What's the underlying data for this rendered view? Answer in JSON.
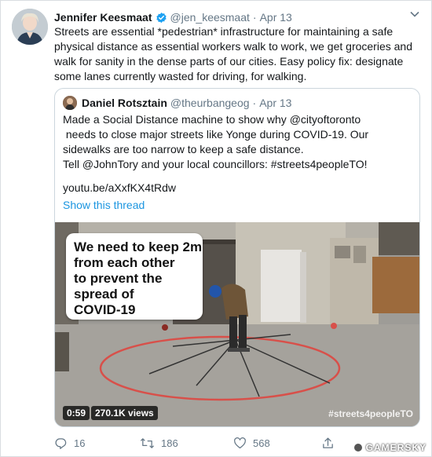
{
  "colors": {
    "link": "#1b95e0",
    "muted": "#657786",
    "verified": "#1da1f2",
    "border": "#ccd6dd"
  },
  "tweet": {
    "author_name": "Jennifer Keesmaat",
    "handle": "@jen_keesmaat",
    "separator": "·",
    "date": "Apr 13",
    "text": "Streets are essential *pedestrian* infrastructure for maintaining a safe physical distance as essential workers walk to work, we get groceries and walk for sanity in the dense parts of our cities. Easy policy fix: designate some lanes currently wasted for driving, for walking.",
    "verified_icon": "verified-badge-icon",
    "menu_icon": "chevron-down-icon"
  },
  "quote": {
    "author_name": "Daniel Rotsztain",
    "handle": "@theurbangeog",
    "separator": "·",
    "date": "Apr 13",
    "lines": [
      "Made a Social Distance machine to show why @cityoftoronto",
      " needs to close major streets like Yonge during COVID-19. Our",
      "sidewalks are too narrow to keep a safe distance.",
      "Tell @JohnTory and your local councillors: #streets4peopleTO!"
    ],
    "link": "youtu.be/aXxfKX4tRdw",
    "show_thread": "Show this thread"
  },
  "video": {
    "caption_lines": [
      "We need to keep 2m",
      "from each other",
      "to prevent the",
      "spread of",
      "COVID-19"
    ],
    "duration": "0:59",
    "views": "270.1K views",
    "hashtag": "#streets4peopleTO"
  },
  "actions": {
    "reply_count": "16",
    "retweet_count": "186",
    "like_count": "568",
    "icons": [
      "reply-icon",
      "retweet-icon",
      "like-icon",
      "share-icon"
    ]
  },
  "watermark": {
    "text": "GAMERSKY"
  }
}
